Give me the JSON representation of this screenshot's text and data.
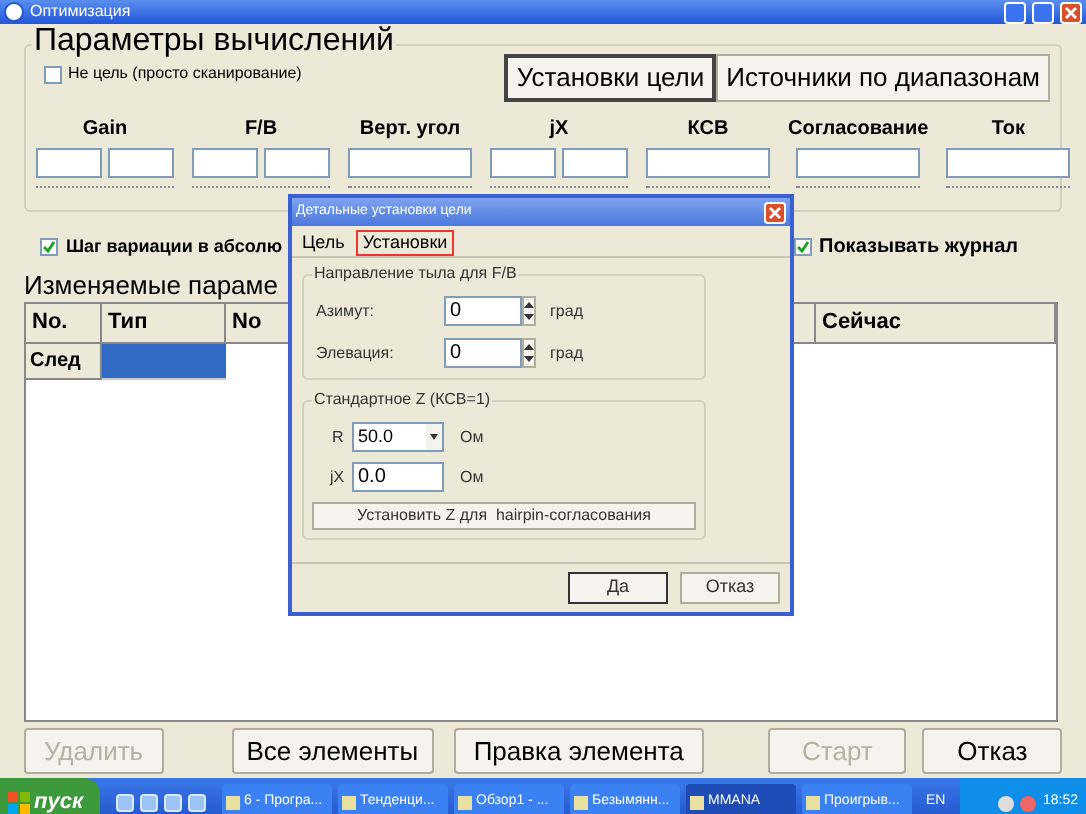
{
  "window": {
    "title": "Оптимизация"
  },
  "calc_group": {
    "legend": "Параметры вычислений",
    "not_target": {
      "label": "Не цель (просто сканирование)",
      "checked": false
    },
    "buttons": [
      {
        "label": "Установки цели",
        "selected": true
      },
      {
        "label": "Источники по диапазонам",
        "selected": false
      }
    ],
    "params": [
      {
        "label": "Gain",
        "kind": "pair"
      },
      {
        "label": "F/B",
        "kind": "pair"
      },
      {
        "label": "Верт. угол",
        "kind": "single"
      },
      {
        "label": "jX",
        "kind": "pair"
      },
      {
        "label": "КСВ",
        "kind": "single"
      },
      {
        "label": "Согласование",
        "kind": "single"
      },
      {
        "label": "Ток",
        "kind": "single"
      }
    ]
  },
  "step_absolute": {
    "label": "Шаг вариации в абсолю",
    "checked": true
  },
  "show_log": {
    "label": "Показывать журнал",
    "checked": true
  },
  "variables": {
    "title": "Изменяемые параме",
    "columns": [
      "No.",
      "Тип",
      "No",
      "Сейчас"
    ],
    "rows": [
      {
        "label": "След",
        "selected": true
      }
    ]
  },
  "bottom_buttons": [
    {
      "label": "Удалить",
      "disabled": true
    },
    {
      "label": "Все элементы",
      "disabled": false
    },
    {
      "label": "Правка элемента",
      "disabled": false
    },
    {
      "label": "Старт",
      "disabled": true
    },
    {
      "label": "Отказ",
      "disabled": false
    }
  ],
  "dialog": {
    "title": "Детальные установки цели",
    "tabs": [
      {
        "label": "Цель",
        "selected": false
      },
      {
        "label": "Установки",
        "selected": true
      }
    ],
    "direction_group": {
      "legend": "Направление тыла для F/B",
      "rows": [
        {
          "label": "Азимут:",
          "value": "0",
          "unit": "град"
        },
        {
          "label": "Элевация:",
          "value": "0",
          "unit": "град"
        }
      ]
    },
    "z_group": {
      "legend": "Стандартное Z (КСВ=1)",
      "r": {
        "label": "R",
        "value": "50.0",
        "unit": "Ом"
      },
      "jx": {
        "label": "jX",
        "value": "0.0",
        "unit": "Ом"
      },
      "button": "Установить Z для  hairpin-согласования"
    },
    "buttons": [
      "Да",
      "Отказ"
    ]
  },
  "taskbar": {
    "start": "пуск",
    "tasks": [
      {
        "label": "6 - Програ...",
        "selected": false
      },
      {
        "label": "Тенденци...",
        "selected": false
      },
      {
        "label": "Обзор1 - ...",
        "selected": false
      },
      {
        "label": "Безымянн...",
        "selected": false
      },
      {
        "label": "MMANA",
        "selected": true
      },
      {
        "label": "Проигрыв...",
        "selected": false
      }
    ],
    "language": "EN",
    "clock": "18:52"
  }
}
